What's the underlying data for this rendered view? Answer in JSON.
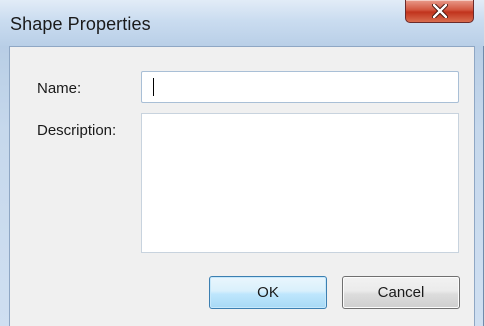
{
  "dialog": {
    "title": "Shape Properties",
    "close_symbol": "x",
    "close_icon": "close-icon"
  },
  "form": {
    "name_label": "Name:",
    "name_value": "",
    "description_label": "Description:",
    "description_value": ""
  },
  "buttons": {
    "ok_label": "OK",
    "cancel_label": "Cancel"
  },
  "colors": {
    "close_button": "#c1331d",
    "ok_button_border": "#3c7fb1",
    "frame": "#b9cfe7"
  }
}
